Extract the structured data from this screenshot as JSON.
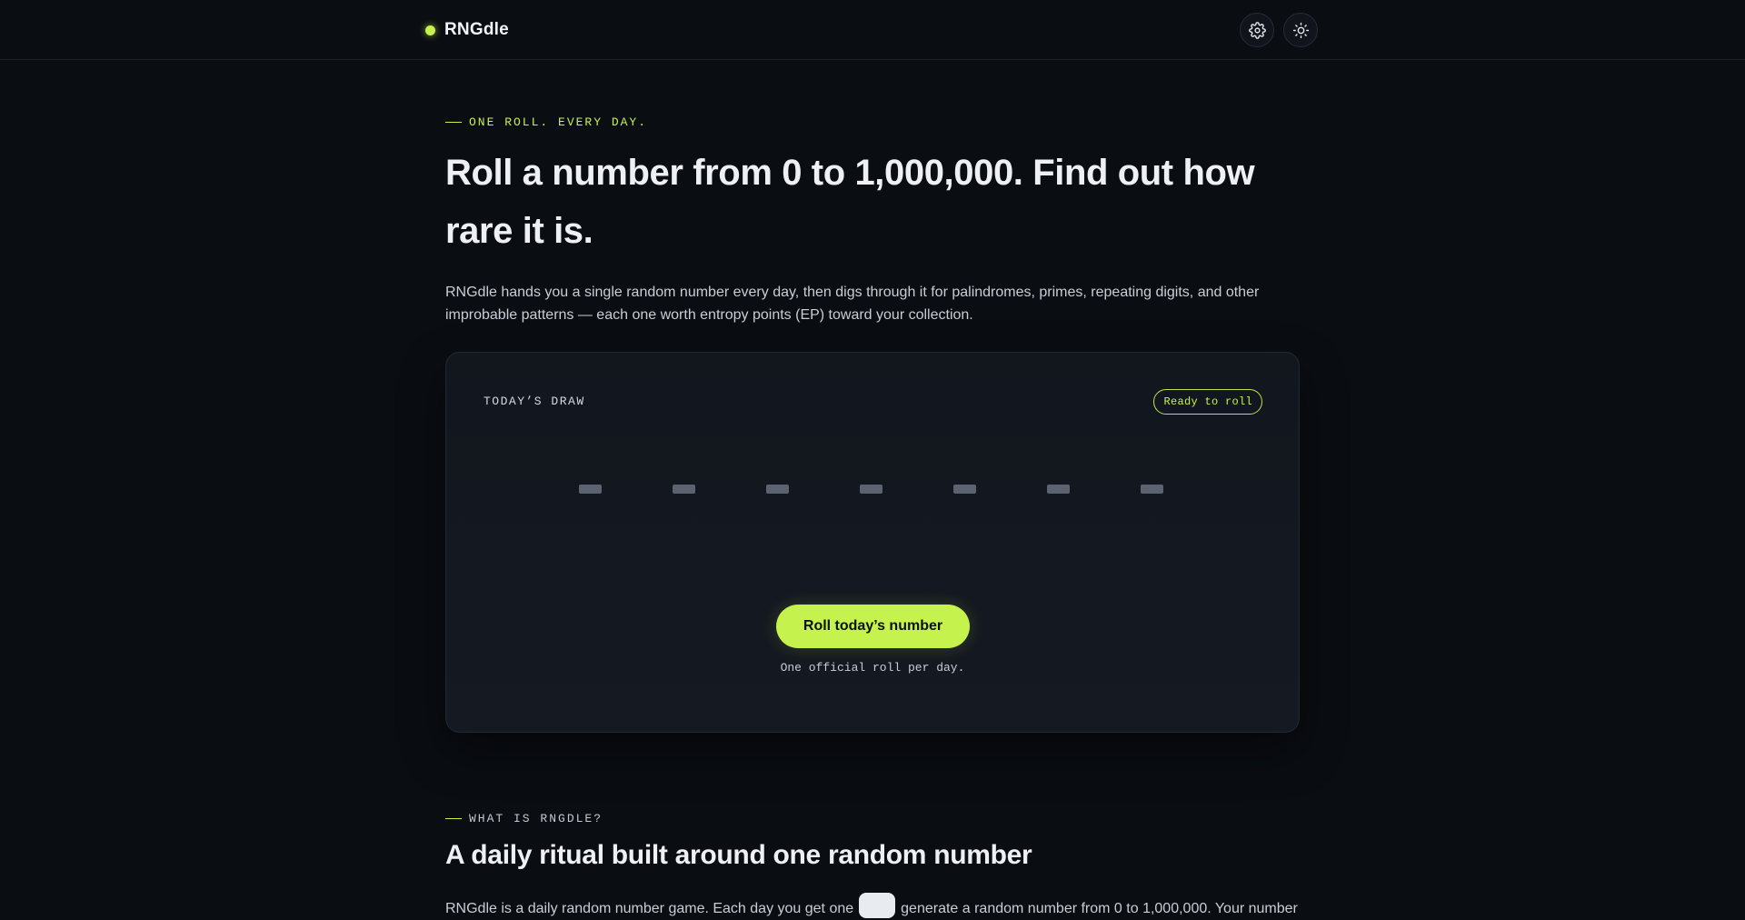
{
  "app": {
    "name": "RNGdle",
    "accent_color": "#c6f24e"
  },
  "header": {
    "settings_icon": "gear-icon",
    "theme_icon": "sun-icon"
  },
  "hero": {
    "eyebrow": "ONE ROLL. EVERY DAY.",
    "title": "Roll a number from 0 to 1,000,000. Find out how rare it is.",
    "description": "RNGdle hands you a single random number every day, then digs through it for palindromes, primes, repeating digits, and other improbable patterns — each one worth entropy points (EP) toward your collection."
  },
  "draw": {
    "label": "TODAY’S DRAW",
    "status": "Ready to roll",
    "digit_slots": 7,
    "button_label": "Roll today’s number",
    "note": "One official roll per day."
  },
  "about": {
    "eyebrow": "WHAT IS RNGDLE?",
    "title": "A daily ritual built around one random number",
    "description_before": "RNGdle is a daily random number game. Each day you get one",
    "description_after": "generate a random number from 0 to 1,000,000. Your number"
  }
}
